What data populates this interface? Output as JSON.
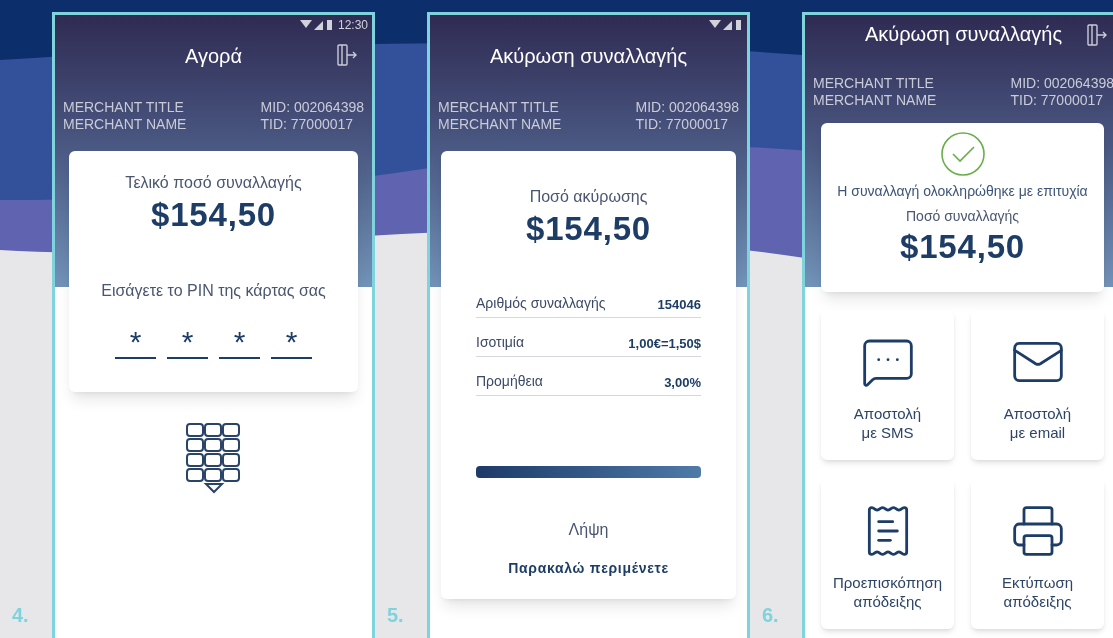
{
  "screens": [
    {
      "kind": "pin",
      "number": "4.",
      "status_bar": true,
      "status_time": "12:30",
      "title": "Αγορά",
      "exit_button": true,
      "merchant": {
        "title": "MERCHANT TITLE",
        "name": "MERCHANT NAME",
        "mid": "MID: 002064398",
        "tid": "TID: 77000017"
      },
      "amount_label": "Τελικό ποσό συναλλαγής",
      "amount": "$154,50",
      "pin_prompt": "Εισάγετε το PIN της κάρτας σας",
      "pin_digits": [
        "*",
        "*",
        "*",
        "*"
      ]
    },
    {
      "kind": "cancel",
      "number": "5.",
      "status_bar": true,
      "title": "Ακύρωση συναλλαγής",
      "exit_button": false,
      "merchant": {
        "title": "MERCHANT TITLE",
        "name": "MERCHANT NAME",
        "mid": "MID: 002064398",
        "tid": "TID: 77000017"
      },
      "amount_label": "Ποσό ακύρωσης",
      "amount": "$154,50",
      "details": [
        {
          "label": "Αριθμός συναλλαγής",
          "value": "154046"
        },
        {
          "label": "Ισοτιμία",
          "value": "1,00€=1,50$"
        },
        {
          "label": "Προμήθεια",
          "value": "3,00%"
        }
      ],
      "progress": {
        "level": 1
      },
      "status": "Λήψη",
      "wait": "Παρακαλώ περιμένετε"
    },
    {
      "kind": "success",
      "number": "6.",
      "status_bar": false,
      "title": "Ακύρωση συναλλαγής",
      "exit_button": true,
      "merchant": {
        "title": "MERCHANT TITLE",
        "name": "MERCHANT NAME",
        "mid": "MID: 002064398",
        "tid": "TID: 77000017"
      },
      "message": "Η συναλλαγή ολοκληρώθηκε με επιτυχία",
      "amount_label": "Ποσό συναλλαγής",
      "amount": "$154,50",
      "actions": [
        {
          "kind": "sms",
          "lines": [
            "Αποστολή",
            "με SMS"
          ]
        },
        {
          "kind": "email",
          "lines": [
            "Αποστολή",
            "με email"
          ]
        },
        {
          "kind": "preview",
          "lines": [
            "Προεπισκόπηση",
            "απόδειξης"
          ]
        },
        {
          "kind": "print",
          "lines": [
            "Εκτύπωση",
            "απόδειξης"
          ]
        }
      ]
    }
  ]
}
